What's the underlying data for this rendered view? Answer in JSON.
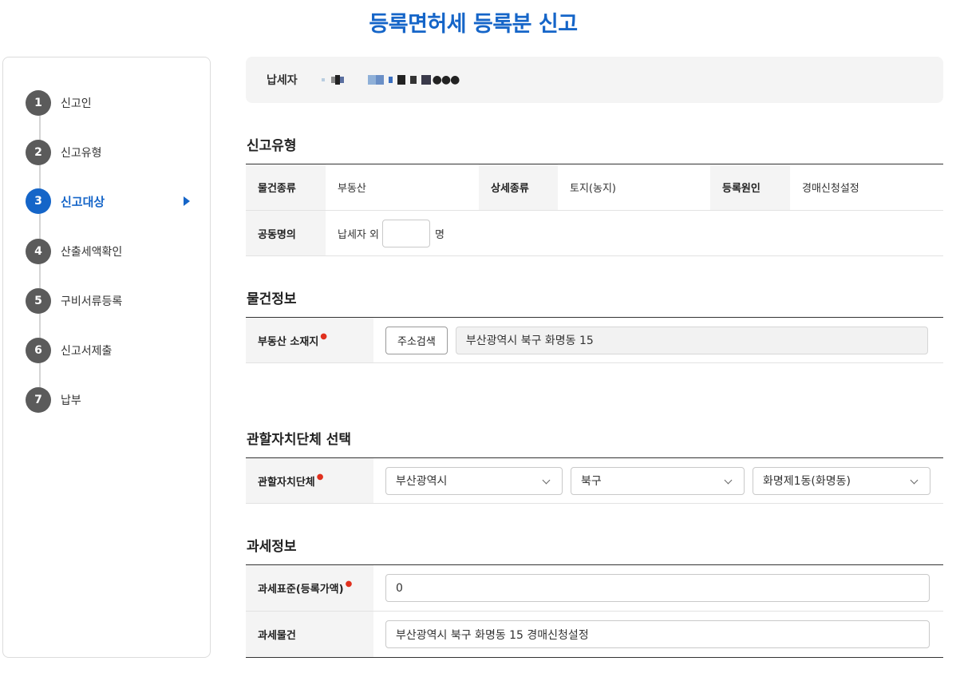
{
  "page_title": "등록면허세 등록분 신고",
  "sidebar": {
    "steps": [
      {
        "num": "1",
        "label": "신고인"
      },
      {
        "num": "2",
        "label": "신고유형"
      },
      {
        "num": "3",
        "label": "신고대상"
      },
      {
        "num": "4",
        "label": "산출세액확인"
      },
      {
        "num": "5",
        "label": "구비서류등록"
      },
      {
        "num": "6",
        "label": "신고서제출"
      },
      {
        "num": "7",
        "label": "납부"
      }
    ],
    "active_step": 3
  },
  "taxpayer": {
    "label": "납세자",
    "masked_suffix": "●●●"
  },
  "report_type": {
    "title": "신고유형",
    "item_kind_label": "물건종류",
    "item_kind_value": "부동산",
    "detail_kind_label": "상세종류",
    "detail_kind_value": "토지(농지)",
    "reg_cause_label": "등록원인",
    "reg_cause_value": "경매신청설정",
    "joint_label": "공동명의",
    "joint_prefix": "납세자 외",
    "joint_count": "",
    "joint_suffix": "명"
  },
  "property_info": {
    "title": "물건정보",
    "location_label": "부동산 소재지",
    "search_button": "주소검색",
    "address": "부산광역시 북구 화명동 15"
  },
  "jurisdiction": {
    "title": "관할자치단체 선택",
    "label": "관할자치단체",
    "city": "부산광역시",
    "district": "북구",
    "dong": "화명제1동(화명동)"
  },
  "tax_info": {
    "title": "과세정보",
    "base_label": "과세표준(등록가액)",
    "base_value": "0",
    "object_label": "과세물건",
    "object_value": "부산광역시 북구 화명동 15 경매신청설정"
  },
  "colors": {
    "accent": "#1565c8",
    "required": "#e0301e",
    "step_inactive": "#5b5b5b",
    "header_bg": "#f4f4f4"
  }
}
